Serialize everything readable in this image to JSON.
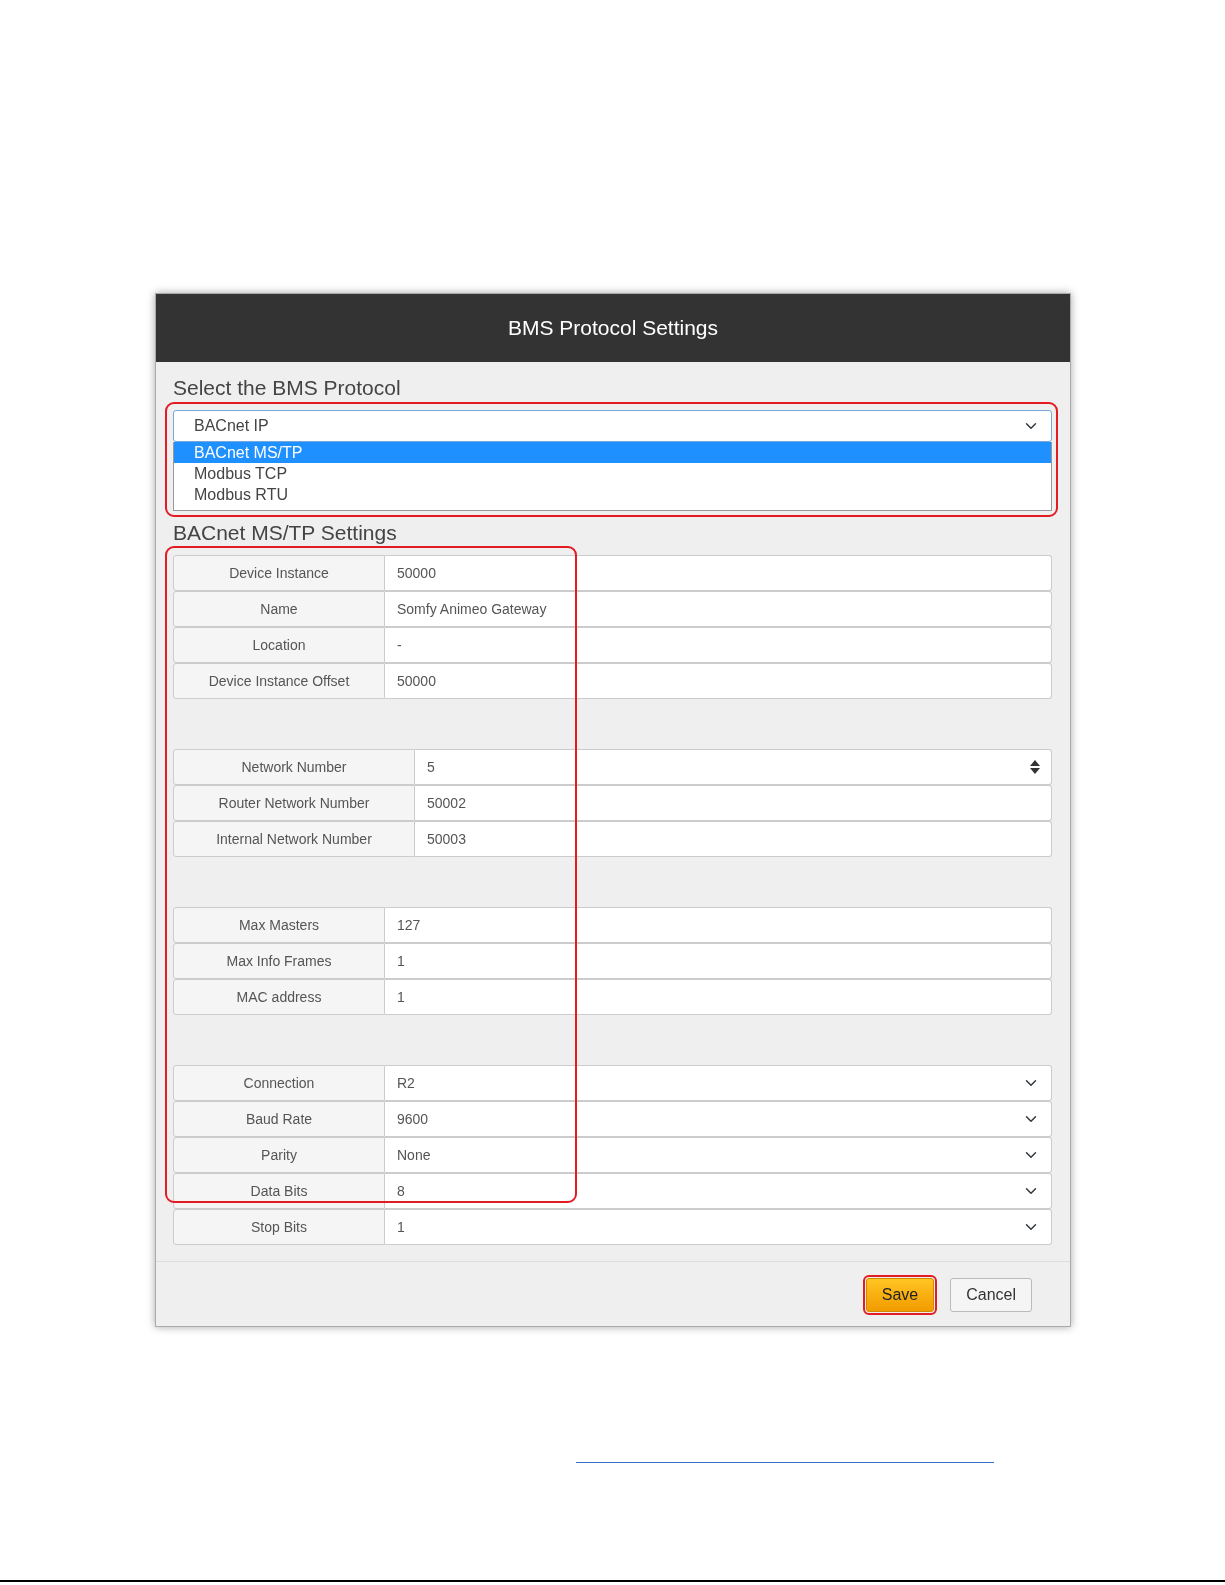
{
  "dialog": {
    "title": "BMS Protocol Settings",
    "protocol": {
      "label": "Select the BMS Protocol",
      "value": "BACnet IP",
      "highlighted": true,
      "options": [
        {
          "label": "BACnet MS/TP",
          "selected": true
        },
        {
          "label": "Modbus TCP",
          "selected": false
        },
        {
          "label": "Modbus RTU",
          "selected": false
        }
      ]
    },
    "settings": {
      "title": "BACnet MS/TP Settings",
      "highlighted": true,
      "groups": [
        {
          "fields": [
            {
              "label": "Device Instance",
              "value": "50000",
              "kind": "text"
            },
            {
              "label": "Name",
              "value": "Somfy Animeo Gateway",
              "kind": "text"
            },
            {
              "label": "Location",
              "value": "-",
              "kind": "text"
            },
            {
              "label": "Device Instance Offset",
              "value": "50000",
              "kind": "text"
            }
          ]
        },
        {
          "fields": [
            {
              "label": "Network Number",
              "value": "5",
              "kind": "number"
            },
            {
              "label": "Router Network Number",
              "value": "50002",
              "kind": "text"
            },
            {
              "label": "Internal Network Number",
              "value": "50003",
              "kind": "text"
            }
          ]
        },
        {
          "fields": [
            {
              "label": "Max Masters",
              "value": "127",
              "kind": "text"
            },
            {
              "label": "Max Info Frames",
              "value": "1",
              "kind": "text"
            },
            {
              "label": "MAC address",
              "value": "1",
              "kind": "text"
            }
          ]
        },
        {
          "fields": [
            {
              "label": "Connection",
              "value": "R2",
              "kind": "select"
            },
            {
              "label": "Baud Rate",
              "value": "9600",
              "kind": "select"
            },
            {
              "label": "Parity",
              "value": "None",
              "kind": "select"
            },
            {
              "label": "Data Bits",
              "value": "8",
              "kind": "select"
            },
            {
              "label": "Stop Bits",
              "value": "1",
              "kind": "select"
            }
          ]
        }
      ]
    },
    "buttons": [
      {
        "label": "Save",
        "kind": "primary",
        "highlighted": true
      },
      {
        "label": "Cancel",
        "kind": "default",
        "highlighted": false
      }
    ]
  }
}
